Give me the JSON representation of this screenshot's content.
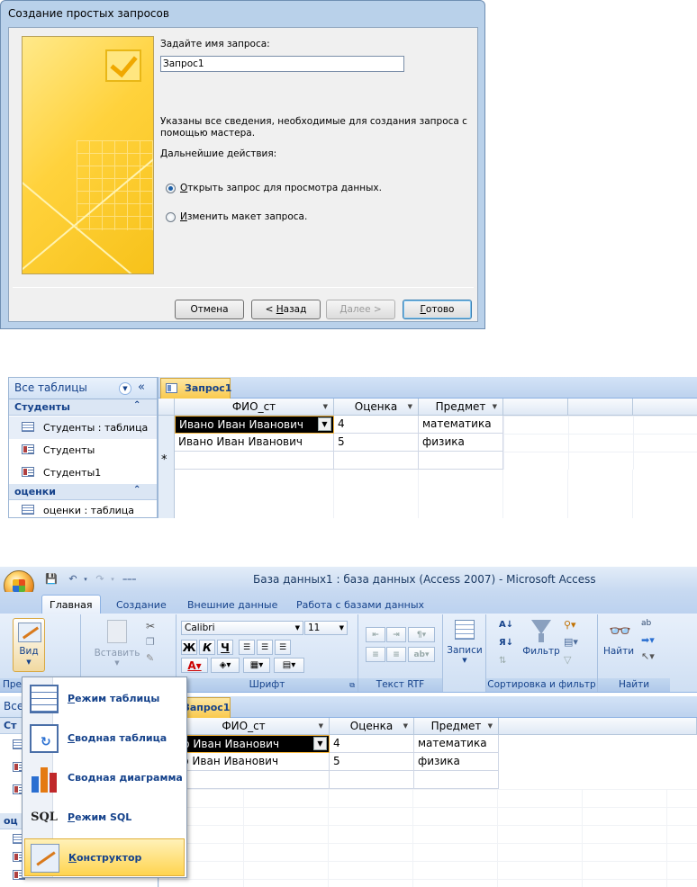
{
  "wizard": {
    "title": "Создание простых запросов",
    "name_prompt": "Задайте имя запроса:",
    "name_value": "Запрос1",
    "info_line1": "Указаны все сведения, необходимые для создания запроса с",
    "info_line2": "помощью мастера.",
    "next_actions": "Дальнейшие действия:",
    "option_open_prefix": "О",
    "option_open_rest": "ткрыть запрос для просмотра данных.",
    "option_modify_prefix": "И",
    "option_modify_rest": "зменить макет запроса.",
    "selected_option": "open",
    "btn_cancel": "Отмена",
    "btn_back_prefix": "< ",
    "btn_back_u": "Н",
    "btn_back_rest": "азад",
    "btn_next_u": "Д",
    "btn_next_rest": "алее >",
    "btn_finish_u": "Г",
    "btn_finish_rest": "отово"
  },
  "nav_pane": {
    "header": "Все таблицы",
    "collapse_glyph": "«",
    "group_students": "Студенты",
    "items_students": [
      "Студенты : таблица",
      "Студенты",
      "Студенты1"
    ],
    "group_grades": "оценки",
    "items_grades": [
      "оценки : таблица"
    ]
  },
  "query_tab": "Запрос1",
  "grid": {
    "columns": [
      "ФИО_ст",
      "Оценка",
      "Предмет"
    ],
    "rows": [
      [
        "Ивано Иван Иванович",
        "4",
        "математика"
      ],
      [
        "Ивано Иван Иванович",
        "5",
        "физика"
      ]
    ],
    "new_row_marker": "*"
  },
  "app": {
    "title": "База данных1 : база данных (Access 2007) - Microsoft Access",
    "tabs": [
      "Главная",
      "Создание",
      "Внешние данные",
      "Работа с базами данных"
    ],
    "active_tab": "Главная",
    "view_label": "Вид",
    "paste_label": "Вставить",
    "font_name": "Calibri",
    "font_size": "11",
    "bold": "Ж",
    "italic": "К",
    "underline": "Ч",
    "group_font": "Шрифт",
    "group_rtf": "Текст RTF",
    "records_label": "Записи",
    "filter_label": "Фильтр",
    "group_sort": "Сортировка и фильтр",
    "find_label": "Найти",
    "group_find": "Найти",
    "group_views_partial": "Пре"
  },
  "view_menu": [
    {
      "label_u": "Р",
      "label_rest": "ежим таблицы",
      "icon": "datasheet-icon"
    },
    {
      "label_u": "С",
      "label_rest": "водная таблица",
      "icon": "pivot-table-icon"
    },
    {
      "label_u": "",
      "label_rest": "Сводная диаграмма",
      "icon": "pivot-chart-icon"
    },
    {
      "label_u": "Р",
      "label_rest": "ежим SQL",
      "icon": "sql-icon",
      "icon_text": "SQL"
    },
    {
      "label_u": "К",
      "label_rest": "онструктор",
      "icon": "design-view-icon",
      "highlighted": true
    }
  ],
  "nav2_partial": {
    "header": "Все",
    "group1": "Ст",
    "group2": "оц"
  },
  "grid2_first_cell": "вано Иван Иванович",
  "grid2_second_cell": "вано Иван Иванович"
}
